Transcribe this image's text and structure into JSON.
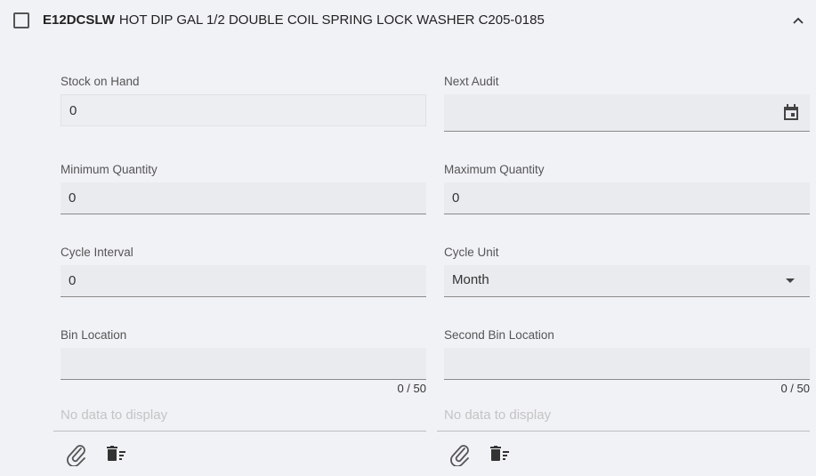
{
  "header": {
    "code": "E12DCSLW",
    "description": "HOT DIP GAL 1/2 DOUBLE COIL SPRING LOCK WASHER C205-0185"
  },
  "fields": {
    "stock_on_hand": {
      "label": "Stock on Hand",
      "value": "0"
    },
    "next_audit": {
      "label": "Next Audit",
      "value": ""
    },
    "minimum_quantity": {
      "label": "Minimum Quantity",
      "value": "0"
    },
    "maximum_quantity": {
      "label": "Maximum Quantity",
      "value": "0"
    },
    "cycle_interval": {
      "label": "Cycle Interval",
      "value": "0"
    },
    "cycle_unit": {
      "label": "Cycle Unit",
      "value": "Month"
    },
    "bin_location": {
      "label": "Bin Location",
      "value": "",
      "counter": "0 / 50"
    },
    "second_bin_location": {
      "label": "Second Bin Location",
      "value": "",
      "counter": "0 / 50"
    }
  },
  "attachments": {
    "left_empty_text": "No data to display",
    "right_empty_text": "No data to display"
  },
  "icons": {
    "calendar": "calendar-icon",
    "dropdown": "caret-down-icon",
    "collapse": "chevron-up-icon",
    "attach": "paperclip-icon",
    "clear": "delete-sweep-icon"
  }
}
